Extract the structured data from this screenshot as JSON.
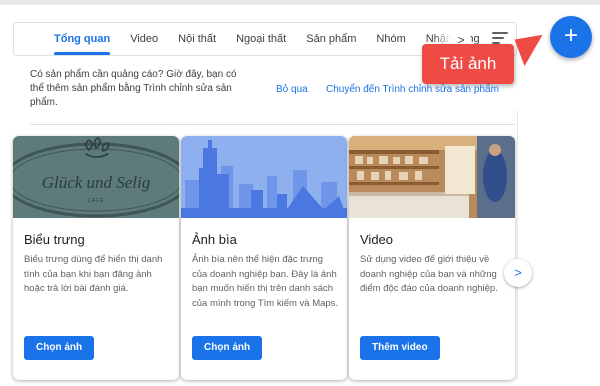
{
  "tabs": [
    "Tổng quan",
    "Video",
    "Nội thất",
    "Ngoại thất",
    "Sản phẩm",
    "Nhóm",
    "Nhận dạng"
  ],
  "tabs_next_symbol": ">",
  "fab_symbol": "+",
  "callout_label": "Tải ảnh",
  "notice": {
    "text": "Có sản phẩm cần quảng cáo? Giờ đây, bạn có thể thêm sản phẩm bằng Trình chỉnh sửa sản phẩm.",
    "skip_label": "Bỏ qua",
    "go_label": "Chuyển đến Trình chỉnh sửa sản phẩm"
  },
  "cards": [
    {
      "title": "Biểu trưng",
      "desc": "Biểu trưng dùng để hiển thị danh tính của bạn khi bạn đăng ảnh hoặc trả lời bài đánh giá.",
      "button": "Chọn ảnh",
      "sign_text": "Glück und Selig",
      "sign_sub": "CAFE"
    },
    {
      "title": "Ảnh bìa",
      "desc": "Ảnh bìa nên thể hiện đặc trưng của doanh nghiệp bạn. Đây là ảnh bạn muốn hiển thị trên danh sách của mình trong Tìm kiếm và Maps.",
      "button": "Chọn ảnh"
    },
    {
      "title": "Video",
      "desc": "Sử dụng video để giới thiệu về doanh nghiệp của bạn và những điểm độc đáo của doanh nghiệp.",
      "button": "Thêm video"
    }
  ],
  "next_symbol": ">",
  "colors": {
    "accent": "#1a73e8",
    "callout": "#ef4b45",
    "logo_bg": "#5e7b7c",
    "cover_sky": "#8fb0ee",
    "cover_city": "#4a78e0"
  }
}
